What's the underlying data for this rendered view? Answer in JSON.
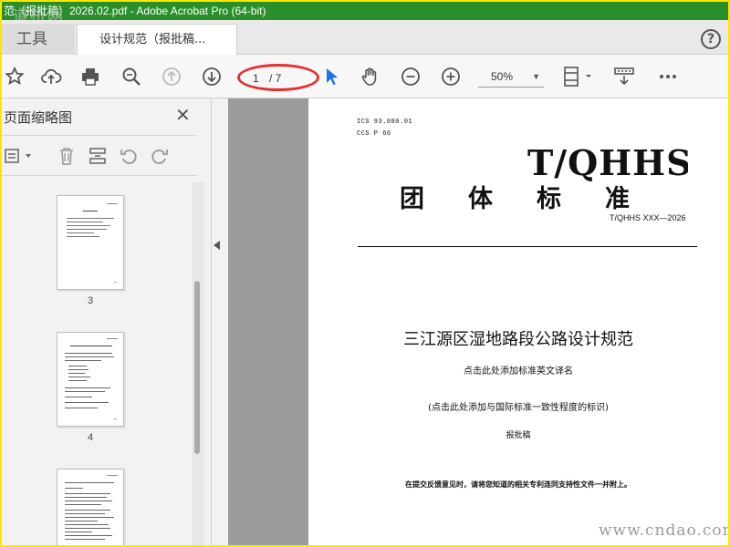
{
  "window": {
    "title": "范（报批稿）2026.02.pdf - Adobe Acrobat Pro (64-bit)",
    "brand_overlay": "道桥网"
  },
  "tabs": {
    "tools_label": "工具",
    "doc_label": "设计规范（报批稿..."
  },
  "toolbar": {
    "current_page": "1",
    "total_pages": "/ 7",
    "zoom": "50%"
  },
  "sidebar": {
    "title": "页面缩略图",
    "thumbnails": [
      {
        "label": "3"
      },
      {
        "label": "4"
      },
      {
        "label": ""
      }
    ]
  },
  "document": {
    "ics": "ICS 93.080.01",
    "ccs": "CCS P 66",
    "std_code": "T/QHHS",
    "org": "团体标准",
    "number": "T/QHHS XXX—2026",
    "title": "三江源区湿地路段公路设计规范",
    "english_title": "点击此处添加标准英文译名",
    "intl_note": "(点击此处添加与国际标准一致性程度的标识)",
    "draft": "报批稿",
    "notice": "在提交反馈意见时，请将您知道的相关专利连同支持性文件一并附上。"
  },
  "watermark": "www.cndao.com",
  "colors": {
    "title_bar": "#2a8f2a",
    "highlight_ring": "#e53030",
    "cursor_blue": "#1a73e8",
    "frame": "#ffe600"
  }
}
